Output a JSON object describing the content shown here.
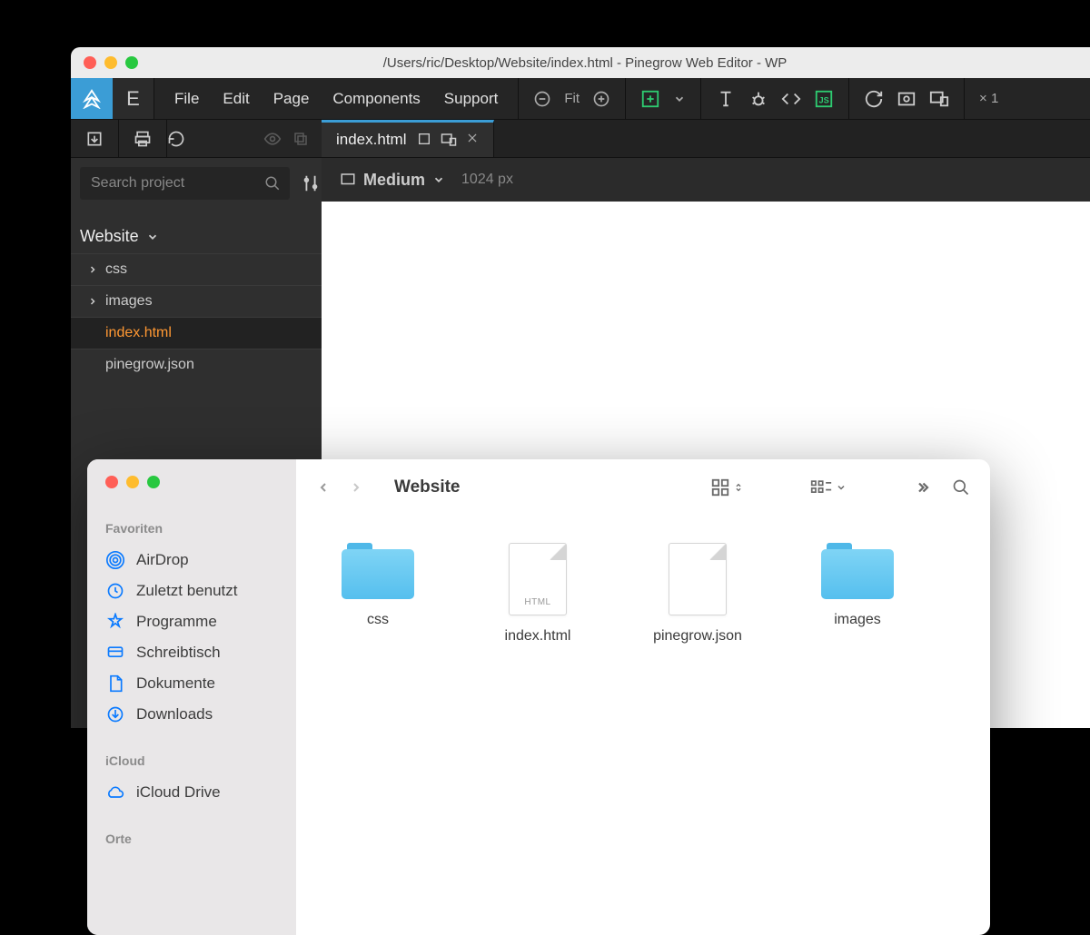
{
  "pinegrow": {
    "title": "/Users/ric/Desktop/Website/index.html - Pinegrow Web Editor - WP",
    "menus": [
      "File",
      "Edit",
      "Page",
      "Components",
      "Support"
    ],
    "fit": "Fit",
    "zoom_label": "× 1",
    "search_placeholder": "Search project",
    "tree": {
      "root": "Website",
      "items": [
        {
          "name": "css",
          "type": "folder"
        },
        {
          "name": "images",
          "type": "folder"
        },
        {
          "name": "index.html",
          "type": "file",
          "selected": true
        },
        {
          "name": "pinegrow.json",
          "type": "file"
        }
      ]
    },
    "tab": {
      "label": "index.html"
    },
    "viewport": {
      "label": "Medium",
      "size": "1024 px"
    }
  },
  "finder": {
    "title": "Website",
    "sidebar": {
      "sections": [
        {
          "heading": "Favoriten",
          "items": [
            "AirDrop",
            "Zuletzt benutzt",
            "Programme",
            "Schreibtisch",
            "Dokumente",
            "Downloads"
          ]
        },
        {
          "heading": "iCloud",
          "items": [
            "iCloud Drive"
          ]
        },
        {
          "heading": "Orte",
          "items": []
        }
      ]
    },
    "items": [
      {
        "name": "css",
        "type": "folder"
      },
      {
        "name": "index.html",
        "type": "file",
        "badge": "HTML"
      },
      {
        "name": "pinegrow.json",
        "type": "file",
        "badge": ""
      },
      {
        "name": "images",
        "type": "folder"
      }
    ]
  }
}
